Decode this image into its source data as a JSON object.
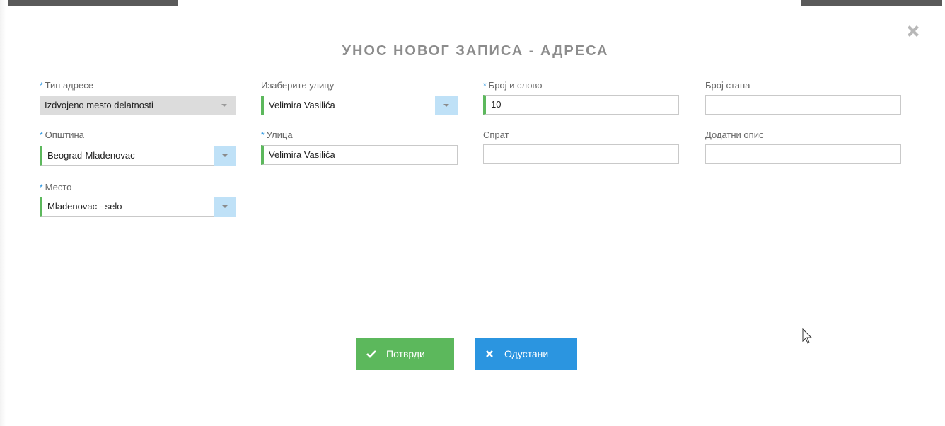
{
  "dialog": {
    "title": "УНОС НОВОГ ЗАПИСА - АДРЕСА",
    "close_icon": "close-icon"
  },
  "form": {
    "address_type": {
      "label": "Тип адресе",
      "required": true,
      "value": "Izdvojeno mesto delatnosti"
    },
    "municipality": {
      "label": "Општина",
      "required": true,
      "value": "Beograd-Mladenovac"
    },
    "place": {
      "label": "Место",
      "required": true,
      "value": "Mladenovac - selo"
    },
    "street_select": {
      "label": "Изаберите улицу",
      "required": false,
      "value": "Velimira Vasilića"
    },
    "street": {
      "label": "Улица",
      "required": true,
      "value": "Velimira Vasilića"
    },
    "number": {
      "label": "Број и слово",
      "required": true,
      "value": "10"
    },
    "floor": {
      "label": "Спрат",
      "required": false,
      "value": ""
    },
    "apartment": {
      "label": "Број стана",
      "required": false,
      "value": ""
    },
    "extra_desc": {
      "label": "Додатни опис",
      "required": false,
      "value": ""
    },
    "required_marker": "*"
  },
  "buttons": {
    "confirm": "Потврди",
    "cancel": "Одустани"
  },
  "colors": {
    "accent_green": "#5cb85c",
    "accent_blue": "#2b95e0",
    "dropdown_arrow_bg": "#bfe1f7",
    "title_gray": "#8c8c8c"
  }
}
